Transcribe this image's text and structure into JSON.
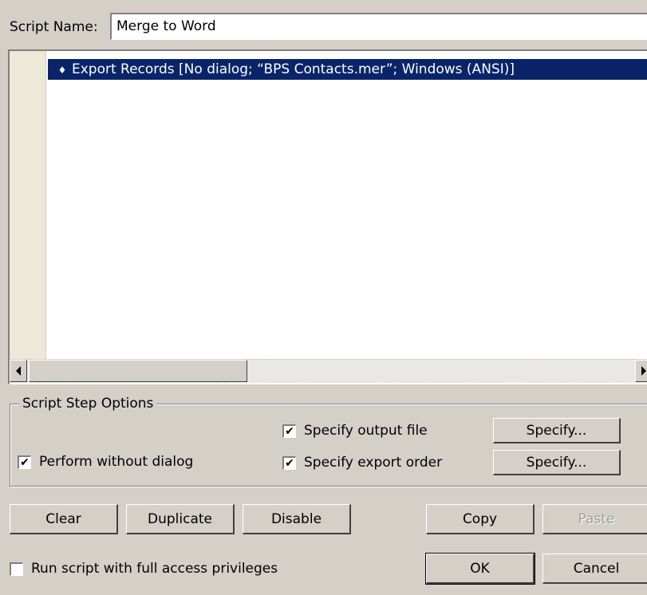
{
  "script_name": {
    "label": "Script Name:",
    "value": "Merge to Word"
  },
  "steps": [
    {
      "text": "Export Records [No dialog; “BPS Contacts.mer”; Windows (ANSI)]",
      "selected": true,
      "icon": "drag-handle-icon"
    }
  ],
  "options": {
    "legend": "Script Step Options",
    "perform_without_dialog": {
      "label": "Perform without dialog",
      "checked": true
    },
    "specify_output_file": {
      "label": "Specify output file",
      "checked": true,
      "button": "Specify..."
    },
    "specify_export_order": {
      "label": "Specify export order",
      "checked": true,
      "button": "Specify..."
    }
  },
  "actions": {
    "clear": "Clear",
    "duplicate": "Duplicate",
    "disable": "Disable",
    "copy": "Copy",
    "paste": "Paste"
  },
  "full_access": {
    "label": "Run script with full access privileges",
    "checked": false
  },
  "dialog_buttons": {
    "ok": "OK",
    "cancel": "Cancel"
  },
  "check_mark": "✔",
  "grip_glyph": "♦"
}
